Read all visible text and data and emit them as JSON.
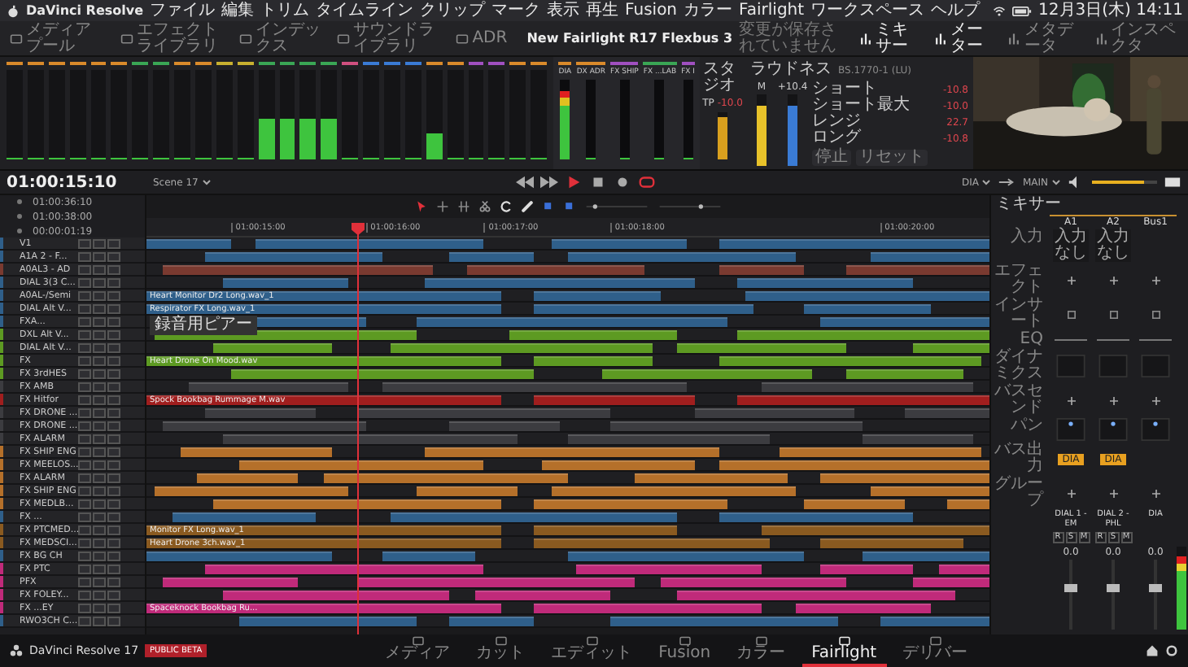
{
  "menubar": {
    "app": "DaVinci Resolve",
    "menus": [
      "ファイル",
      "編集",
      "トリム",
      "タイムライン",
      "クリップ",
      "マーク",
      "表示",
      "再生",
      "Fusion",
      "カラー",
      "Fairlight",
      "ワークスペース",
      "ヘルプ"
    ],
    "clock": "12月3日(木) 14:11"
  },
  "toolbar": {
    "left": [
      {
        "label": "メディアプール",
        "selected": false
      },
      {
        "label": "エフェクトライブラリ",
        "selected": false
      },
      {
        "label": "インデックス",
        "selected": false
      },
      {
        "label": "サウンドライブラリ",
        "selected": false
      },
      {
        "label": "ADR",
        "selected": false
      }
    ],
    "title": "New Fairlight R17 Flexbus 3",
    "status": "変更が保存されていません",
    "right": [
      {
        "label": "ミキサー",
        "selected": true
      },
      {
        "label": "メーター",
        "selected": true
      },
      {
        "label": "メタデータ",
        "selected": false
      },
      {
        "label": "インスペクタ",
        "selected": false
      }
    ]
  },
  "meters": [
    {
      "color": "#d98a2b",
      "level": 0
    },
    {
      "color": "#d98a2b",
      "level": 0
    },
    {
      "color": "#d98a2b",
      "level": 0
    },
    {
      "color": "#d98a2b",
      "level": 0
    },
    {
      "color": "#d98a2b",
      "level": 0
    },
    {
      "color": "#d98a2b",
      "level": 0
    },
    {
      "color": "#3aa655",
      "level": 0
    },
    {
      "color": "#3aa655",
      "level": 0
    },
    {
      "color": "#d98a2b",
      "level": 0
    },
    {
      "color": "#d98a2b",
      "level": 0
    },
    {
      "color": "#c8b030",
      "level": 0
    },
    {
      "color": "#c8b030",
      "level": 0
    },
    {
      "color": "#3aa655",
      "level": 0.45
    },
    {
      "color": "#3aa655",
      "level": 0.45
    },
    {
      "color": "#3aa655",
      "level": 0.45
    },
    {
      "color": "#3aa655",
      "level": 0.45
    },
    {
      "color": "#d05080",
      "level": 0
    },
    {
      "color": "#3a7bd5",
      "level": 0
    },
    {
      "color": "#3a7bd5",
      "level": 0
    },
    {
      "color": "#3a7bd5",
      "level": 0
    },
    {
      "color": "#d98a2b",
      "level": 0.3
    },
    {
      "color": "#d98a2b",
      "level": 0
    },
    {
      "color": "#a050c0",
      "level": 0
    },
    {
      "color": "#a050c0",
      "level": 0
    },
    {
      "color": "#d98a2b",
      "level": 0
    },
    {
      "color": "#d98a2b",
      "level": 0
    }
  ],
  "buses": [
    {
      "name": "DIA",
      "color": "#d98a2b",
      "level": 0.85
    },
    {
      "name": "DX ADR",
      "color": "#d98a2b",
      "level": 0
    },
    {
      "name": "FX SHIP",
      "color": "#a050c0",
      "level": 0
    },
    {
      "name": "FX ...LAB",
      "color": "#3aa655",
      "level": 0
    },
    {
      "name": "FX I",
      "color": "#a050c0",
      "level": 0
    }
  ],
  "studio": {
    "title": "スタジオ",
    "tp_label": "TP",
    "tp_value": "-10.0",
    "level": 0.9
  },
  "loudness": {
    "title": "ラウドネス",
    "standard": "BS.1770-1 (LU)",
    "meters": [
      {
        "label": "M",
        "color": "#e8c22a",
        "level": 0.85
      },
      {
        "label": "+10.4",
        "color": "#3a7bd5",
        "level": 0.85
      }
    ],
    "readings": [
      {
        "label": "ショート",
        "value": "-10.8"
      },
      {
        "label": "ショート最大",
        "value": "-10.0"
      },
      {
        "label": "レンジ",
        "value": "22.7"
      },
      {
        "label": "ロング",
        "value": "-10.8"
      }
    ],
    "buttons": [
      "停止",
      "リセット"
    ]
  },
  "viewer": {
    "kind": "picture"
  },
  "transport": {
    "timecode": "01:00:15:10",
    "timeline": "Scene 17",
    "output_from": "DIA",
    "output_to": "MAIN",
    "volume": {
      "level": 0.8
    }
  },
  "history": [
    "01:00:36:10",
    "01:00:38:00",
    "00:00:01:19"
  ],
  "ruler": [
    "01:00:15:00",
    "01:00:16:00",
    "01:00:17:00",
    "01:00:18:00",
    "01:00:20:00"
  ],
  "tooltip": "録音用ピアー",
  "tracks": [
    {
      "name": "V1",
      "color": "#2f5f8a"
    },
    {
      "name": "A1A 2 - F...",
      "color": "#2f5f8a"
    },
    {
      "name": "A0AL3 - AD",
      "color": "#7a3a30"
    },
    {
      "name": "DIAL 3(3 C...",
      "color": "#2f5f8a"
    },
    {
      "name": "A0AL-/Semi",
      "color": "#2f5f8a",
      "clip": "Heart Monitor Dr2 Long.wav_1"
    },
    {
      "name": "DIAL Alt V...",
      "color": "#2f5f8a",
      "clip": "Respirator FX Long.wav_1"
    },
    {
      "name": "FXA...",
      "color": "#2f5f8a"
    },
    {
      "name": "DXL Alt V...",
      "color": "#5d9a22"
    },
    {
      "name": "DIAL Alt V...",
      "color": "#5d9a22"
    },
    {
      "name": "FX",
      "color": "#5d9a22",
      "clip": "Heart Drone On Mood.wav"
    },
    {
      "name": "FX 3rdHES",
      "color": "#5d9a22"
    },
    {
      "name": "FX AMB",
      "color": "#3c3c40"
    },
    {
      "name": "FX Hitfor",
      "color": "#a01e1e",
      "clip": "Spock Bookbag Rummage M.wav"
    },
    {
      "name": "FX DRONE ...",
      "color": "#3c3c40"
    },
    {
      "name": "FX DRONE ...",
      "color": "#3c3c40"
    },
    {
      "name": "FX ALARM",
      "color": "#3c3c40"
    },
    {
      "name": "FX SHIP ENG",
      "color": "#b5702a"
    },
    {
      "name": "FX MEELOS...",
      "color": "#b5702a"
    },
    {
      "name": "FX ALARM",
      "color": "#b5702a"
    },
    {
      "name": "FX SHIP ENG",
      "color": "#b5702a"
    },
    {
      "name": "FX MEDLB...",
      "color": "#b5702a"
    },
    {
      "name": "FX ...",
      "color": "#2f5f8a"
    },
    {
      "name": "FX PTCMED...",
      "color": "#8a5a20",
      "clip": "Monitor FX Long.wav_1"
    },
    {
      "name": "FX MEDSCI...",
      "color": "#8a5a20",
      "clip": "Heart Drone 3ch.wav_1"
    },
    {
      "name": "FX BG CH",
      "color": "#2f5f8a"
    },
    {
      "name": "FX PTC",
      "color": "#c02a7a"
    },
    {
      "name": "PFX",
      "color": "#c02a7a"
    },
    {
      "name": "FX FOLEY...",
      "color": "#c02a7a"
    },
    {
      "name": "FX ...EY",
      "color": "#c02a7a",
      "clip": "Spaceknock Bookbag Ru..."
    },
    {
      "name": "RWO3CH C...",
      "color": "#2f5f8a"
    }
  ],
  "mixer": {
    "title": "ミキサー",
    "rows": [
      {
        "label": "入力",
        "kind": "input"
      },
      {
        "label": "エフェクト",
        "kind": "effects"
      },
      {
        "label": "インサート",
        "kind": "insert"
      },
      {
        "label": "EQ",
        "kind": "eq"
      },
      {
        "label": "ダイナミクス",
        "kind": "dynamics"
      },
      {
        "label": "バスセンド",
        "kind": "send"
      },
      {
        "label": "パン",
        "kind": "pan"
      },
      {
        "label": "バス出力",
        "kind": "bus"
      },
      {
        "label": "グループ",
        "kind": "group"
      }
    ],
    "channels": [
      {
        "name": "A1",
        "input": "入力なし",
        "bus_out": "DIA",
        "track": "DIAL 1 - EM",
        "buttons": [
          "R",
          "S",
          "M"
        ],
        "value": "0.0",
        "level": 0.6
      },
      {
        "name": "A2",
        "input": "入力なし",
        "bus_out": "DIA",
        "track": "DIAL 2 - PHL",
        "buttons": [
          "R",
          "S",
          "M"
        ],
        "value": "0.0",
        "level": 0.6
      },
      {
        "name": "Bus1",
        "track": "DIA",
        "value": "0.0",
        "level": 0.6
      }
    ],
    "master": {
      "level": 0.88
    }
  },
  "pages": [
    {
      "label": "メディア",
      "selected": false
    },
    {
      "label": "カット",
      "selected": false
    },
    {
      "label": "エディット",
      "selected": false
    },
    {
      "label": "Fusion",
      "selected": false
    },
    {
      "label": "カラー",
      "selected": false
    },
    {
      "label": "Fairlight",
      "selected": true
    },
    {
      "label": "デリバー",
      "selected": false
    }
  ],
  "brand": {
    "name": "DaVinci Resolve 17",
    "badge": "PUBLIC BETA"
  }
}
